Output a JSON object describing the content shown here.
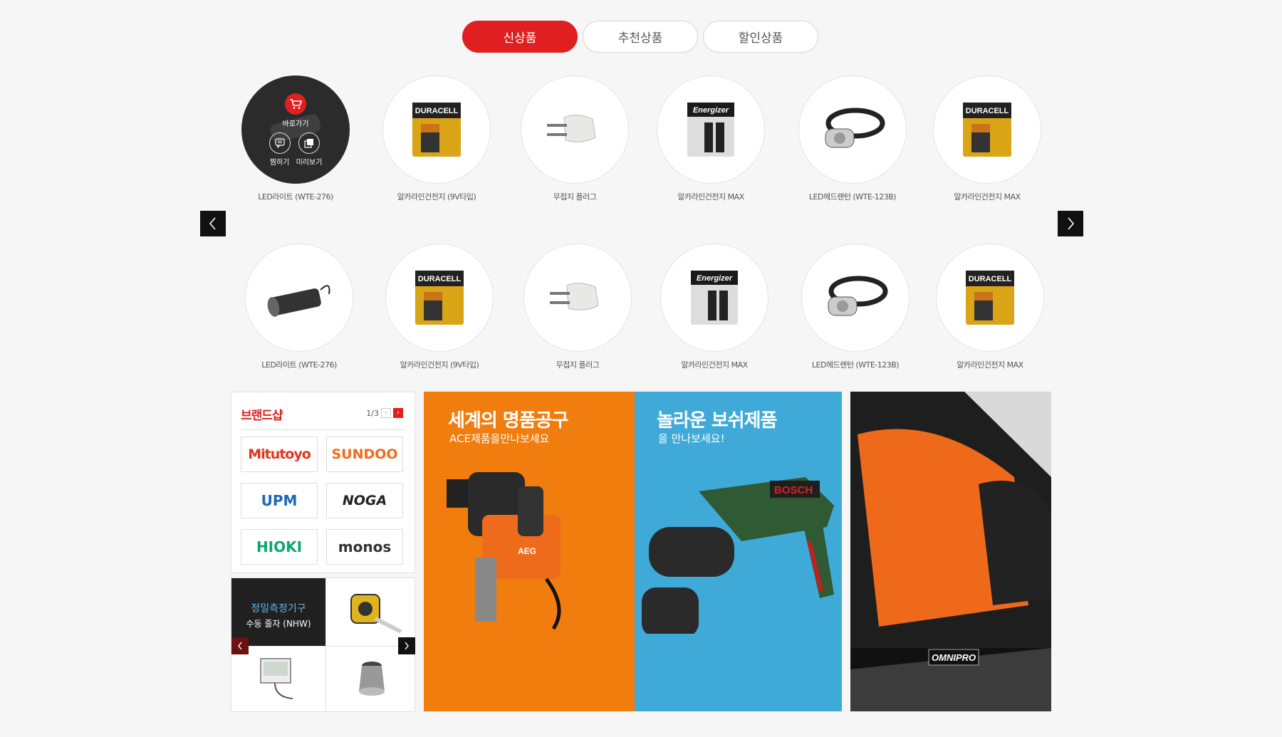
{
  "tabs": [
    {
      "label": "신상품"
    },
    {
      "label": "추천상품"
    },
    {
      "label": "할인상품"
    }
  ],
  "hover_overlay": {
    "cart_label": "바로가기",
    "wish_label": "찜하기",
    "preview_label": "미리보기"
  },
  "products_row1": [
    {
      "name": "LED라이트 (WTE-276)",
      "image": "flashlight"
    },
    {
      "name": "알카라인건전지 (9V타입)",
      "image": "duracell-9v"
    },
    {
      "name": "무접지 플러그",
      "image": "plug"
    },
    {
      "name": "알카라인건전지 MAX",
      "image": "energizer-aa"
    },
    {
      "name": "LED헤드랜턴 (WTE-123B)",
      "image": "headlamp"
    },
    {
      "name": "알카라인건전지 MAX",
      "image": "duracell-9v"
    }
  ],
  "products_row2": [
    {
      "name": "LED라이트 (WTE-276)",
      "image": "flashlight"
    },
    {
      "name": "알카라인건전지 (9V타입)",
      "image": "duracell-9v"
    },
    {
      "name": "무접지 플러그",
      "image": "plug"
    },
    {
      "name": "알카라인건전지 MAX",
      "image": "energizer-aa"
    },
    {
      "name": "LED헤드랜턴 (WTE-123B)",
      "image": "headlamp"
    },
    {
      "name": "알카라인건전지 MAX",
      "image": "duracell-9v"
    }
  ],
  "brand_shop": {
    "title": "브랜드샵",
    "page": "1/3",
    "brands": [
      {
        "name": "Mitutoyo",
        "color": "#e8331c"
      },
      {
        "name": "SUNDOO",
        "color": "#f26a1b"
      },
      {
        "name": "UPM",
        "color": "#1c68b8"
      },
      {
        "name": "NOGA",
        "color": "#222222"
      },
      {
        "name": "HIOKI",
        "color": "#0aa86b"
      },
      {
        "name": "monos",
        "color": "#333333"
      }
    ]
  },
  "measure": {
    "title": "정밀측정기구",
    "subtitle": "수동 줄자 (NHW)"
  },
  "banners": {
    "ace": {
      "title": "세계의 명품공구",
      "subtitle": "ACE제품을만나보세요",
      "bg": "#f07d0d",
      "brand_text": "AEG"
    },
    "bosch": {
      "title": "놀라운 보쉬제품",
      "subtitle": "을 만나보세요!",
      "bg": "#3fa9d8",
      "brand_text": "BOSCH"
    },
    "omnipro": {
      "brand_text": "OMNIPRO"
    }
  },
  "colors": {
    "accent": "#e02020",
    "background": "#f6f6f6"
  }
}
